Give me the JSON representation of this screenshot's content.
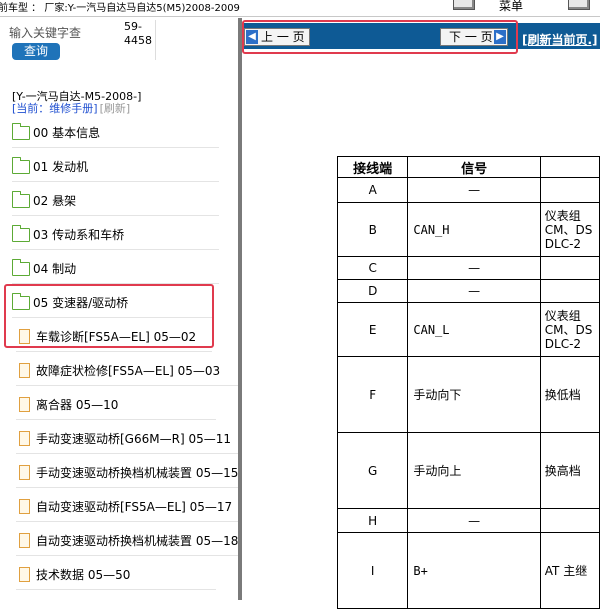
{
  "topbar": {
    "car_text": "前车型 ：  厂家:Y-一汽马自达马自达5(M5)2008-2009",
    "menu_label": "菜单"
  },
  "search": {
    "placeholder": "输入关键字查",
    "button_label": "查询",
    "code": "59-4458"
  },
  "context": {
    "path": "[Y-一汽马自达-M5-2008-]",
    "current": "[当前：维修手册]",
    "refresh": "[刷新]"
  },
  "tree": [
    {
      "label": "00 基本信息",
      "type": "folder"
    },
    {
      "label": "01 发动机",
      "type": "folder"
    },
    {
      "label": "02 悬架",
      "type": "folder"
    },
    {
      "label": "03 传动系和车桥",
      "type": "folder"
    },
    {
      "label": "04 制动",
      "type": "folder"
    },
    {
      "label": "05 变速器/驱动桥",
      "type": "folder-open"
    },
    {
      "label": "车载诊断[FS5A—EL] 05—02",
      "type": "doc"
    },
    {
      "label": "故障症状检修[FS5A—EL] 05—03",
      "type": "doc"
    },
    {
      "label": "离合器 05—10",
      "type": "doc"
    },
    {
      "label": "手动变速驱动桥[G66M—R] 05—11",
      "type": "doc"
    },
    {
      "label": "手动变速驱动桥换档机械装置 05—15",
      "type": "doc"
    },
    {
      "label": "自动变速驱动桥[FS5A—EL] 05—17",
      "type": "doc"
    },
    {
      "label": "自动变速驱动桥换档机械装置 05—18",
      "type": "doc"
    },
    {
      "label": "技术数据 05—50",
      "type": "doc"
    }
  ],
  "nav": {
    "prev_label": "上 一 页",
    "next_label": "下 一 页",
    "refresh_label": "[刷新当前页.]"
  },
  "doc_table": {
    "headers": [
      "接线端",
      "信号",
      ""
    ],
    "rows": [
      {
        "terminal": "A",
        "signal": "—",
        "desc": ""
      },
      {
        "terminal": "B",
        "signal": "CAN_H",
        "desc": "仪表组\nCM、DS\nDLC-2"
      },
      {
        "terminal": "C",
        "signal": "—",
        "desc": ""
      },
      {
        "terminal": "D",
        "signal": "—",
        "desc": ""
      },
      {
        "terminal": "E",
        "signal": "CAN_L",
        "desc": "仪表组\nCM、DS\nDLC-2"
      },
      {
        "terminal": "F",
        "signal": "手动向下",
        "desc": "换低档"
      },
      {
        "terminal": "G",
        "signal": "手动向上",
        "desc": "换高档"
      },
      {
        "terminal": "H",
        "signal": "—",
        "desc": ""
      },
      {
        "terminal": "I",
        "signal": "B+",
        "desc": "AT 主继"
      }
    ]
  }
}
